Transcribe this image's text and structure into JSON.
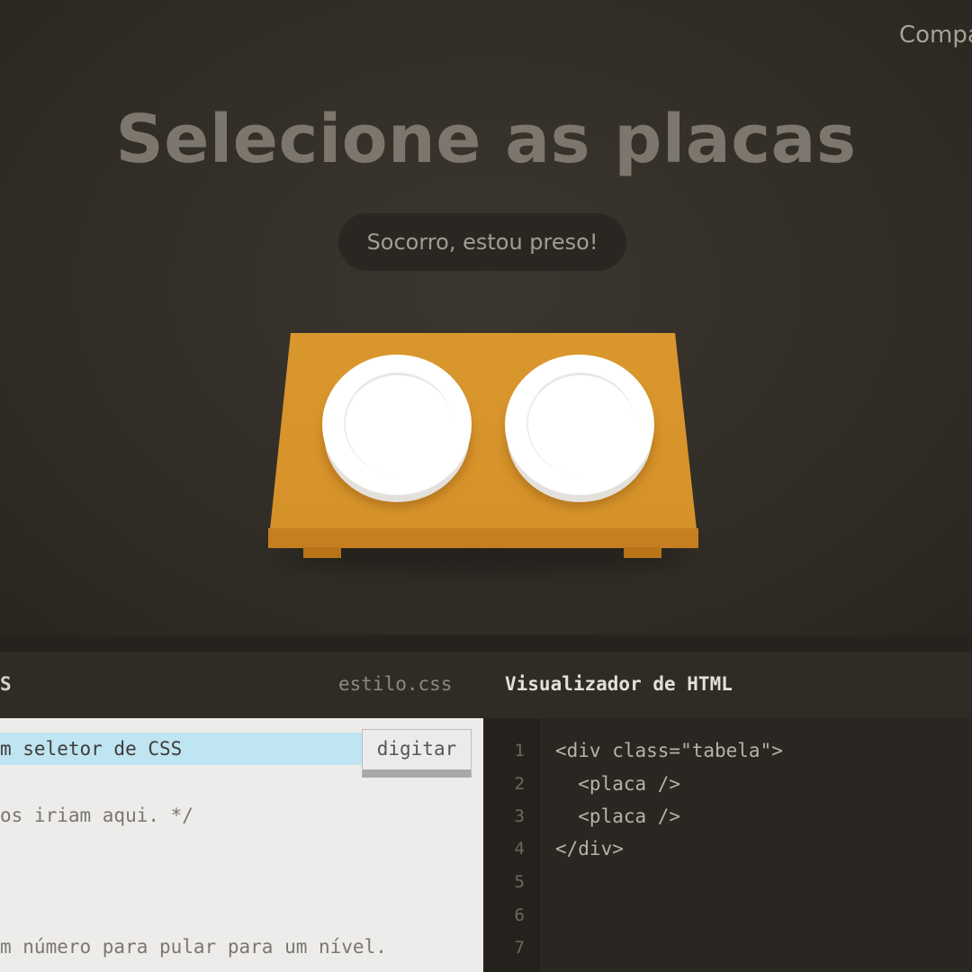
{
  "header": {
    "share_label": "Compa"
  },
  "level": {
    "instruction": "Selecione as placas",
    "help_label": "Socorro, estou preso!"
  },
  "table": {
    "plates": [
      "placa",
      "placa"
    ],
    "colors": {
      "table": "#d9972d",
      "plate": "#ffffff"
    }
  },
  "editor": {
    "css_panel_label": "S",
    "css_file_name": "estilo.css",
    "html_panel_label": "Visualizador de HTML",
    "css_input_placeholder": "m seletor de CSS",
    "enter_button_label": "digitar",
    "css_comment_line": "os iriam aqui. */",
    "css_footer_comment": "m número para pular para um nível.",
    "html_line_numbers": [
      "1",
      "2",
      "3",
      "4",
      "5",
      "6",
      "7"
    ],
    "html_code_lines": [
      "<div class=\"tabela\">",
      "  <placa />",
      "  <placa />",
      "</div>"
    ]
  }
}
